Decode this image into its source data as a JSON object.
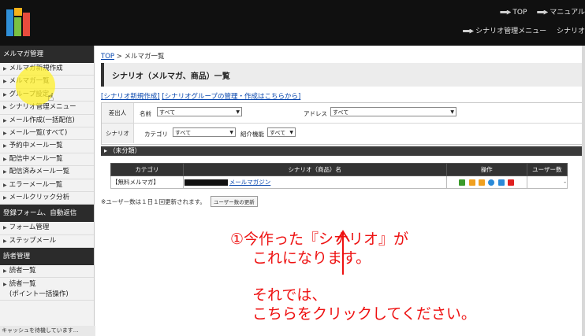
{
  "header": {
    "top_label": "TOP",
    "manual_label": "マニュアル",
    "scenario_menu_label": "シナリオ管理メニュー",
    "scenario_label": "シナリオ"
  },
  "sidebar": {
    "section1": "メルマガ管理",
    "items1": [
      "メルマガ新規作成",
      "メルマガ一覧",
      "グループ設定",
      "シナリオ管理メニュー",
      "メール作成(一括配信)",
      "メール一覧(すべて)",
      "予約中メール一覧",
      "配信中メール一覧",
      "配信済みメール一覧",
      "エラーメール一覧",
      "メールクリック分析"
    ],
    "section2": "登録フォーム、自動返信",
    "items2": [
      "フォーム管理",
      "ステップメール"
    ],
    "section3": "読者管理",
    "items3": [
      "読者一覧"
    ],
    "item_tall_line1": "読者一覧",
    "item_tall_line2": "(ポイント一括操作)",
    "status": "キャッシュを待機しています..."
  },
  "main": {
    "breadcrumb_top": "TOP",
    "breadcrumb_rest": " > メルマガ一覧",
    "title": "シナリオ（メルマガ、商品）一覧",
    "link1": "[シナリオ新規作成]",
    "link2": "[シナリオグループの管理・作成はこちらから]",
    "filter": {
      "row1_head": "差出人",
      "name_label": "名前",
      "name_value": "すべて",
      "address_label": "アドレス",
      "address_value": "すべて",
      "row2_head": "シナリオ",
      "category_label": "カテゴリ",
      "category_value": "すべて",
      "intro_label": "紹介機能",
      "intro_value": "すべて"
    },
    "group_label": "（未分類）",
    "table": {
      "col_category": "カテゴリ",
      "col_name": "シナリオ（商品）名",
      "col_ops": "操作",
      "col_users": "ユーザー数",
      "row_category": "【無料メルマガ】",
      "row_name": "メールマガジン",
      "row_users": "-"
    },
    "note": "※ユーザー数は１日１回更新されます。",
    "update_button": "ユーザー数の更新"
  },
  "annotation": {
    "line1": "①今作った『シナリオ』が",
    "line2": "これになります。",
    "line3": "それでは、",
    "line4": "こちらをクリックしてください。",
    "color": "#ee1111"
  }
}
